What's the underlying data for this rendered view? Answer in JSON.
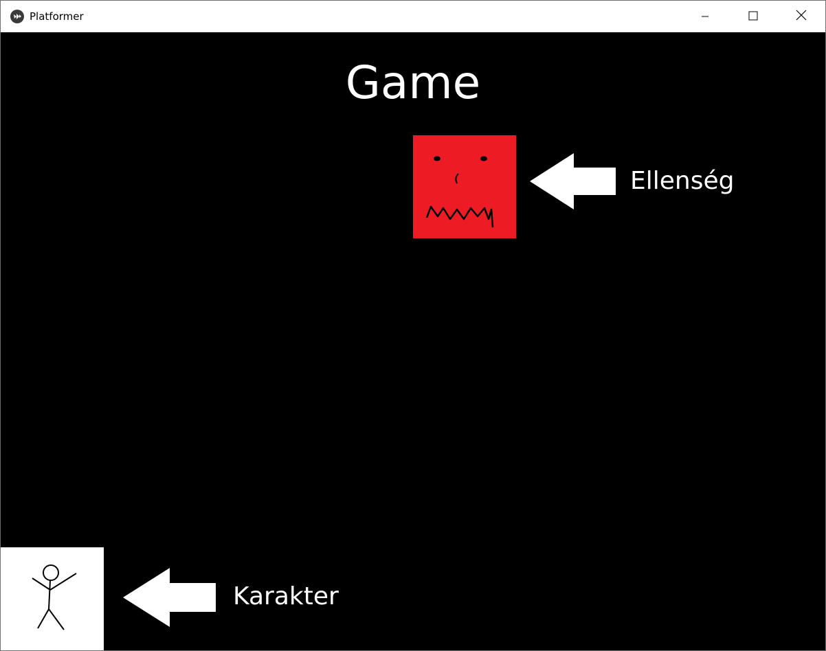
{
  "window": {
    "title": "Platformer",
    "app_icon": "kivy-logo-icon",
    "controls": {
      "minimize_icon": "minimize-icon",
      "maximize_icon": "maximize-icon",
      "close_icon": "close-icon"
    }
  },
  "game": {
    "title": "Game",
    "background_color": "#000000",
    "enemy": {
      "label": "Ellenség",
      "color": "#ed1c24"
    },
    "character": {
      "label": "Karakter",
      "color": "#ffffff"
    },
    "arrow_color": "#ffffff"
  }
}
